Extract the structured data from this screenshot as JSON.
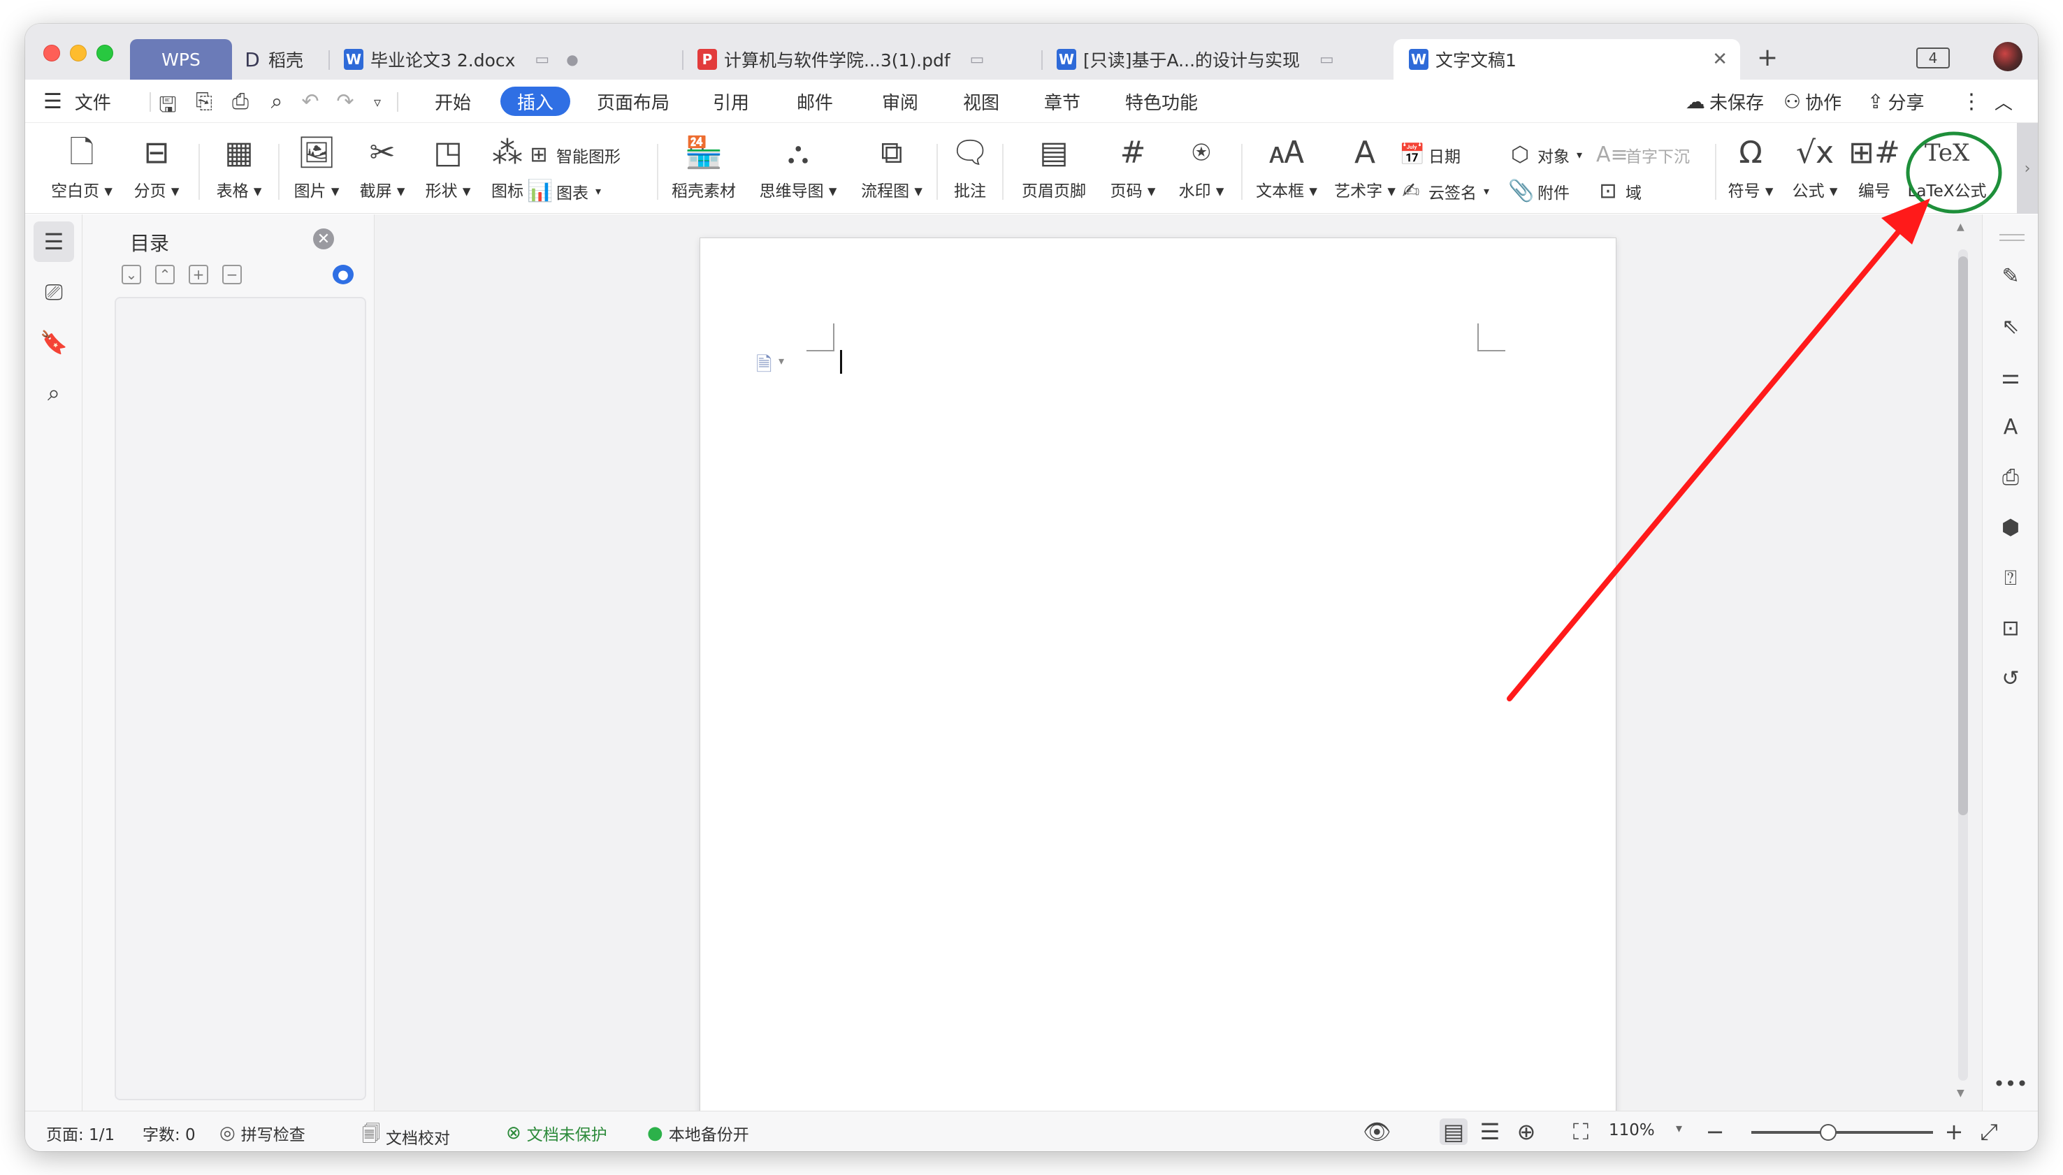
{
  "tabs": [
    {
      "label": "WPS"
    },
    {
      "label": "稻壳"
    },
    {
      "label": "毕业论文3 2.docx"
    },
    {
      "label": "计算机与软件学院...3(1).pdf"
    },
    {
      "label": "[只读]基于A...的设计与实现"
    },
    {
      "label": "文字文稿1"
    }
  ],
  "tabbar": {
    "new_tab": "+",
    "panel_count": "4"
  },
  "menu": {
    "file": "文件",
    "items": [
      "开始",
      "插入",
      "页面布局",
      "引用",
      "邮件",
      "审阅",
      "视图",
      "章节",
      "特色功能"
    ],
    "active": "插入",
    "unsaved": "未保存",
    "collab": "协作",
    "share": "分享"
  },
  "ribbon": {
    "blank_page": "空白页",
    "page_break": "分页",
    "table": "表格",
    "picture": "图片",
    "screenshot": "截屏",
    "shape": "形状",
    "icon": "图标",
    "smart_graphic": "智能图形",
    "chart": "图表",
    "docer_material": "稻壳素材",
    "mindmap": "思维导图",
    "flowchart": "流程图",
    "comment": "批注",
    "header_footer": "页眉页脚",
    "page_number": "页码",
    "watermark": "水印",
    "textbox": "文本框",
    "wordart": "艺术字",
    "date": "日期",
    "cloud_sign": "云签名",
    "object": "对象",
    "attachment": "附件",
    "drop_cap": "首字下沉",
    "field": "域",
    "symbol": "符号",
    "formula": "公式",
    "numbering": "编号",
    "latex": "LaTeX公式"
  },
  "toc": {
    "title": "目录"
  },
  "status": {
    "page": "页面: 1/1",
    "words": "字数: 0",
    "spellcheck": "拼写检查",
    "proofread": "文档校对",
    "unprotected": "文档未保护",
    "backup": "本地备份开",
    "zoom": "110%"
  },
  "colors": {
    "accent": "#2f6fe4",
    "annotation_circle": "#1e8f3a",
    "annotation_arrow": "#ff1a1a"
  }
}
